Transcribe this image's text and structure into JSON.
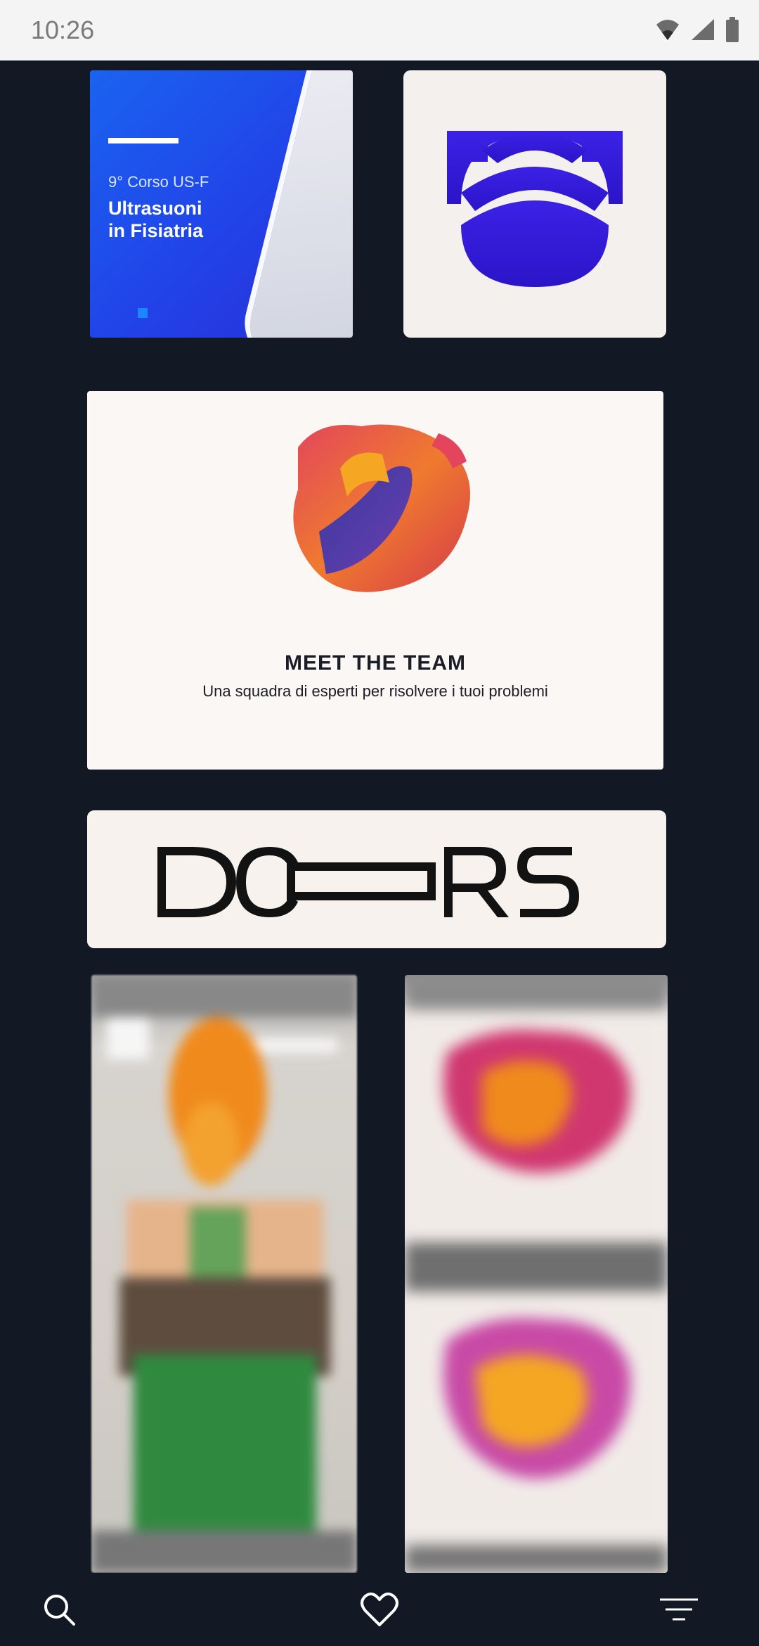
{
  "status_bar": {
    "time": "10:26",
    "icons": [
      "wifi-icon",
      "signal-icon",
      "battery-icon"
    ]
  },
  "feed": {
    "cards": [
      {
        "name": "course-poster",
        "subtitle": "9° Corso US-F",
        "title_line1": "Ultrasuoni",
        "title_line2": "in Fisiatria"
      },
      {
        "name": "ultrasound-logo"
      },
      {
        "name": "meet-the-team",
        "title": "MEET THE TEAM",
        "subtitle": "Una squadra di esperti per risolvere i tuoi problemi"
      },
      {
        "name": "doors-logo",
        "text": "DOORS"
      },
      {
        "name": "candle-photo"
      },
      {
        "name": "blurred-logos"
      }
    ]
  },
  "bottom_nav": {
    "items": [
      {
        "icon": "search-icon"
      },
      {
        "icon": "heart-icon"
      },
      {
        "icon": "menu-icon"
      }
    ]
  },
  "colors": {
    "background": "#121824",
    "status_bar": "#f4f4f4",
    "accent_blue": "#2a3de0",
    "logo_purple": "#3a1fe0",
    "nav_icon": "#ffffff"
  }
}
